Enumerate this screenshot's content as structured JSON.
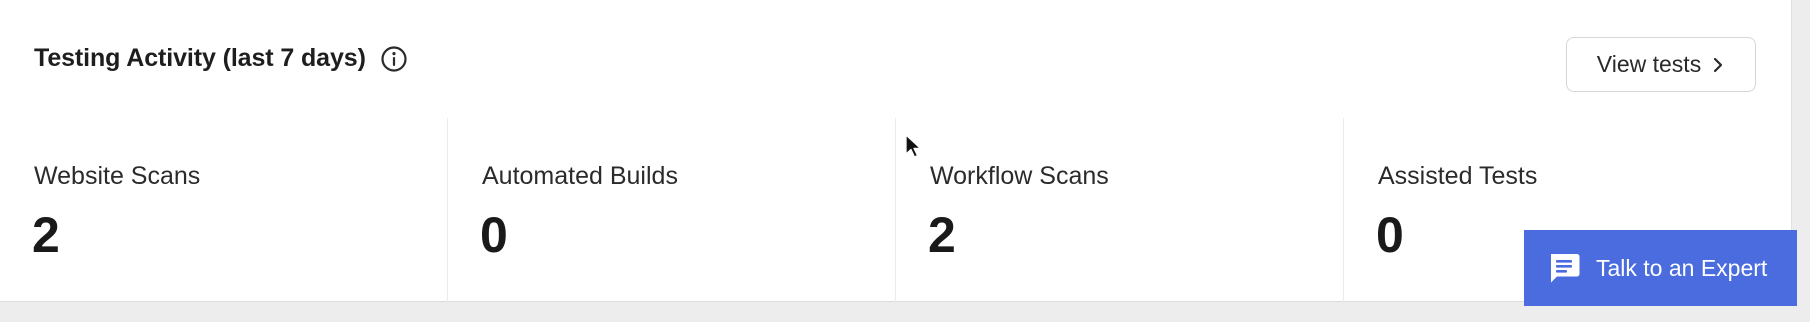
{
  "header": {
    "title": "Testing Activity (last 7 days)",
    "info_icon": "info-circle-icon",
    "view_tests_label": "View tests",
    "view_tests_icon": "chevron-right-icon"
  },
  "stats": [
    {
      "label": "Website Scans",
      "value": "2"
    },
    {
      "label": "Automated Builds",
      "value": "0"
    },
    {
      "label": "Workflow Scans",
      "value": "2"
    },
    {
      "label": "Assisted Tests",
      "value": "0"
    }
  ],
  "expert_button": {
    "label": "Talk to an Expert",
    "icon": "chat-bubble-icon",
    "color": "#4a6cdf"
  }
}
